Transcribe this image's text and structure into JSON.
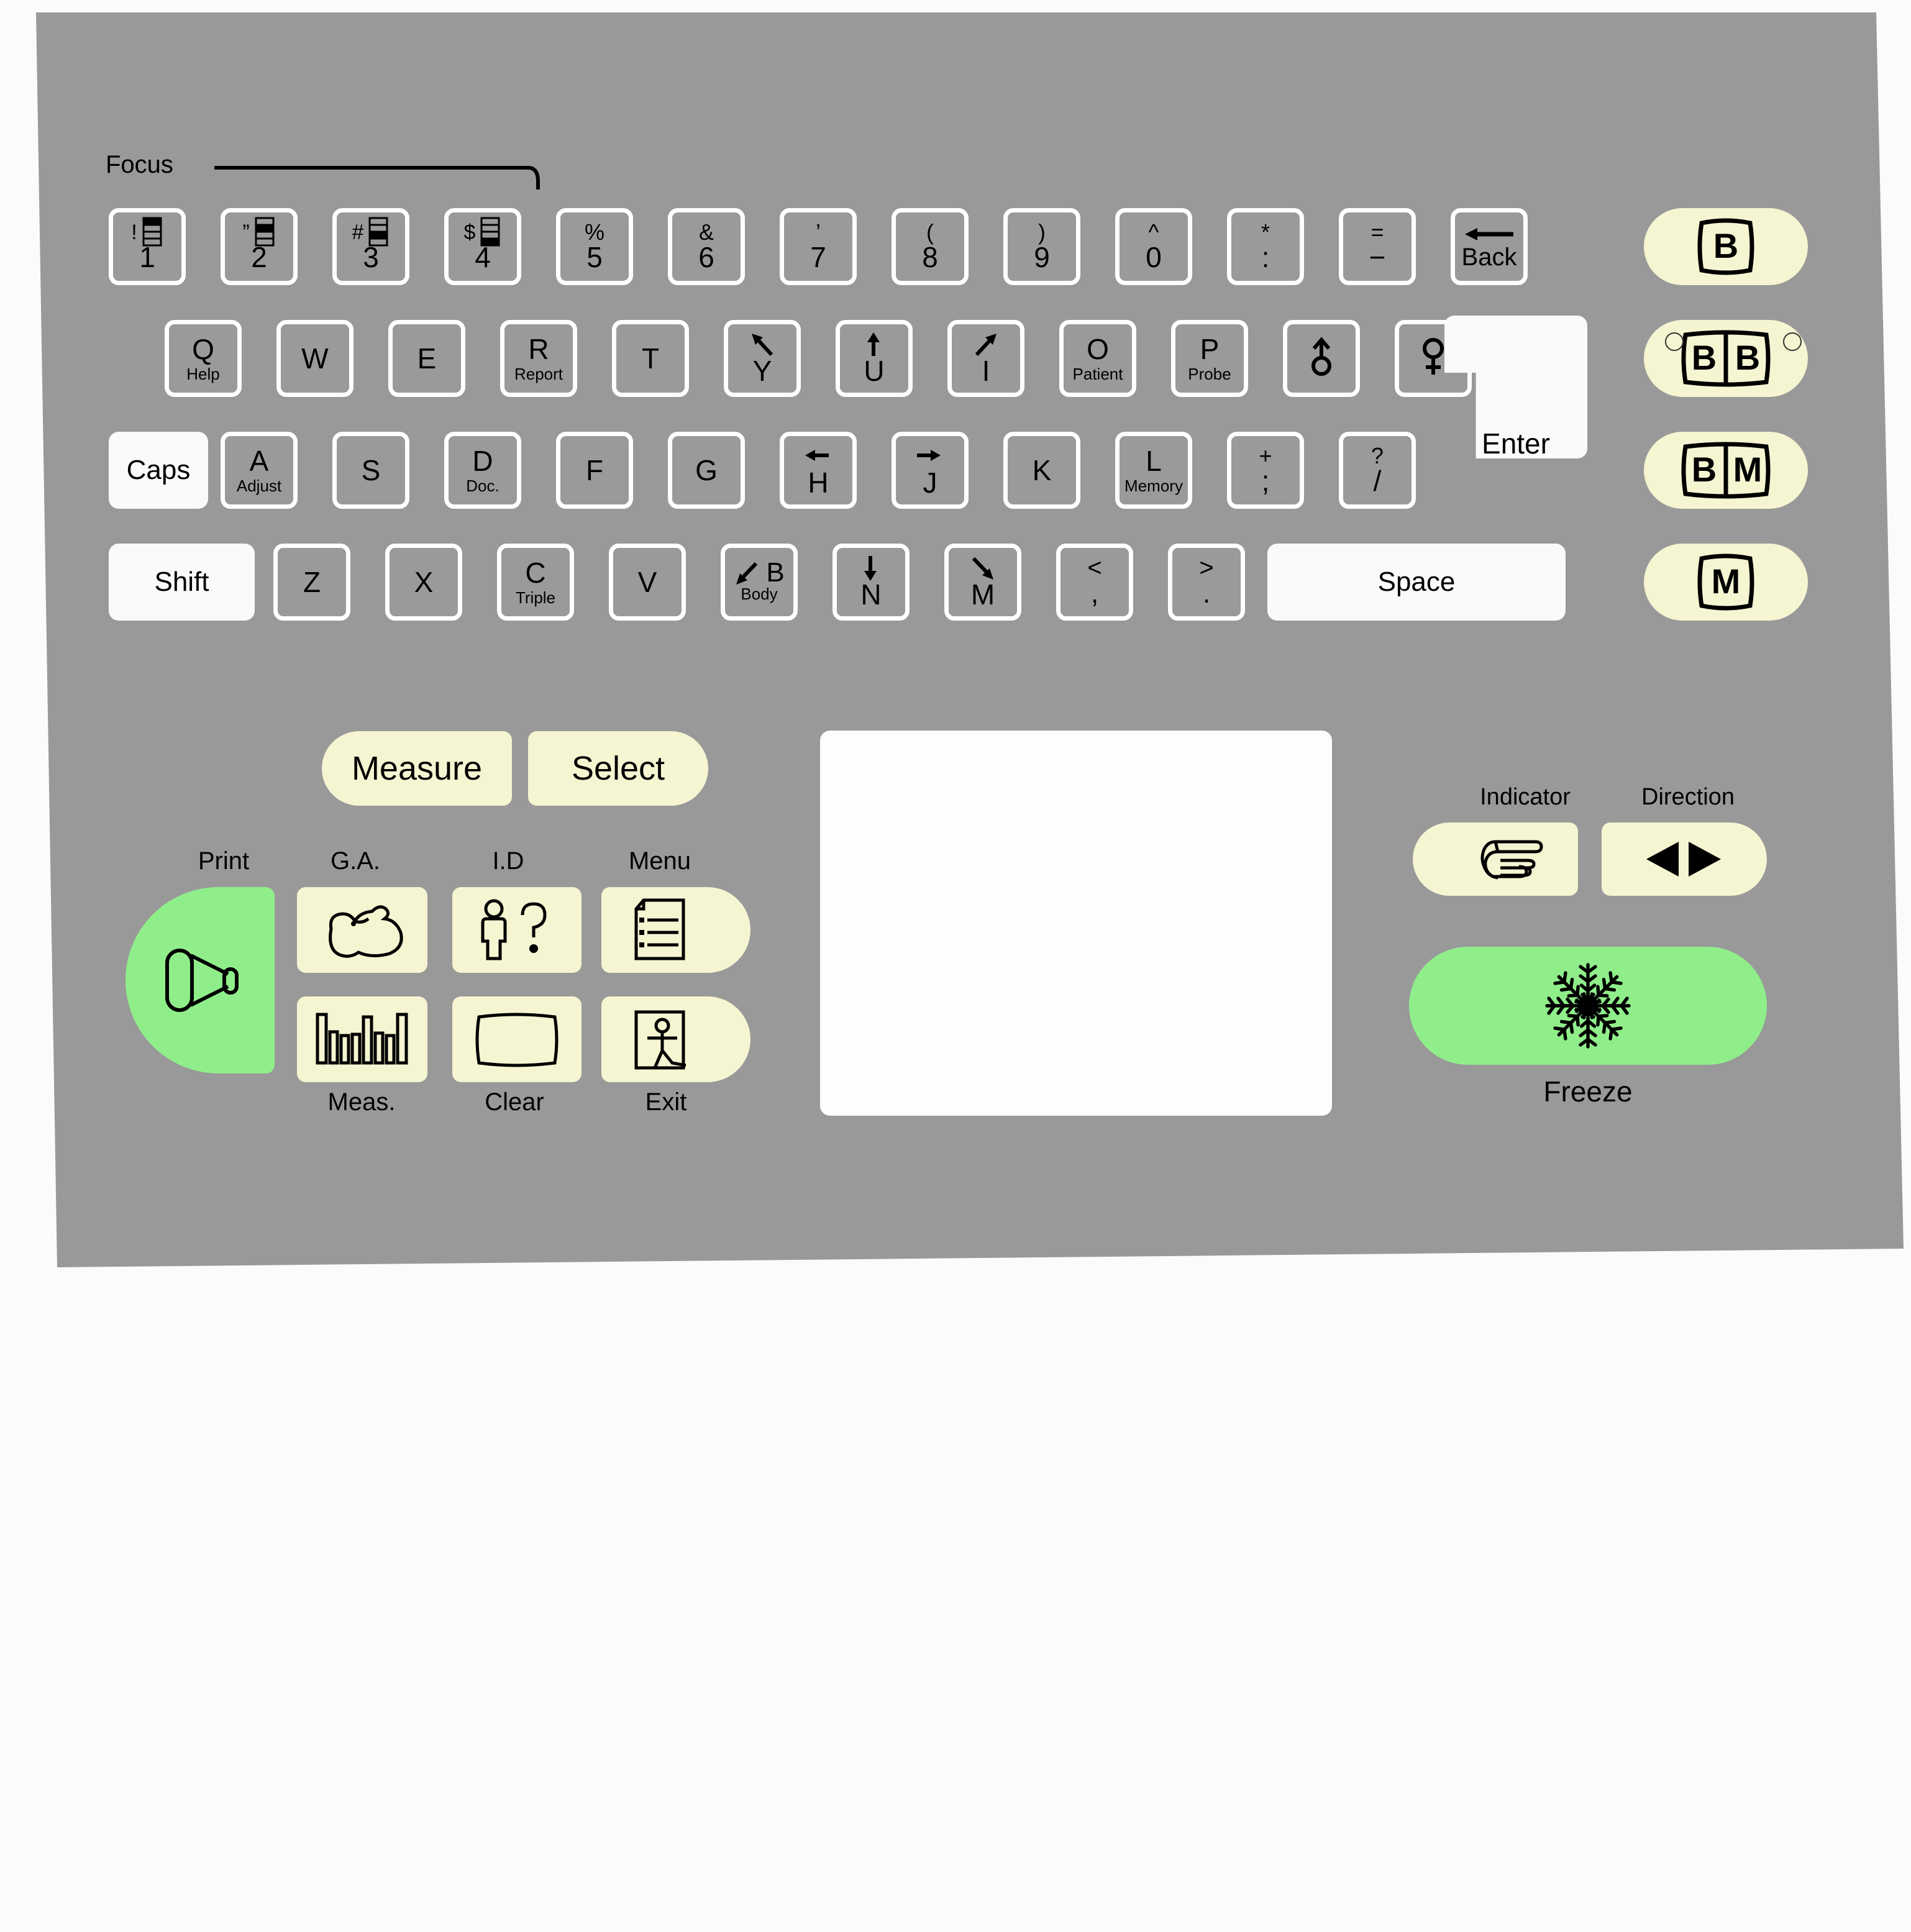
{
  "panel": {
    "name": "ultrasound-control-panel",
    "colors": {
      "body": "#999999",
      "key_face": "#9a9a9a",
      "key_border": "#ffffff",
      "modifier_key": "#fafafa",
      "function_key": "#f5f5d2",
      "action_key": "#90ee8a",
      "led": "#d3d3d3"
    }
  },
  "focus": {
    "label": "Focus",
    "bracket": "focus-bracket-line",
    "keys": [
      {
        "shift": "!",
        "main": "1",
        "icon": "focus-depth-icon-1"
      },
      {
        "shift": "”",
        "main": "2",
        "icon": "focus-depth-icon-2"
      },
      {
        "shift": "#",
        "main": "3",
        "icon": "focus-depth-icon-3"
      },
      {
        "shift": "$",
        "main": "4",
        "icon": "focus-depth-icon-4"
      }
    ]
  },
  "number_row": [
    {
      "shift": "%",
      "main": "5"
    },
    {
      "shift": "&",
      "main": "6"
    },
    {
      "shift": "’",
      "main": "7"
    },
    {
      "shift": "(",
      "main": "8"
    },
    {
      "shift": ")",
      "main": "9"
    },
    {
      "shift": "^",
      "main": "0"
    },
    {
      "shift": "*",
      "main": ":"
    },
    {
      "shift": "=",
      "main": "−"
    },
    {
      "shift": "",
      "main": "Back",
      "icon": "back-arrow-icon"
    }
  ],
  "row_q": [
    {
      "main": "Q",
      "sub": "Help"
    },
    {
      "main": "W",
      "sub": ""
    },
    {
      "main": "E",
      "sub": ""
    },
    {
      "main": "R",
      "sub": "Report"
    },
    {
      "main": "T",
      "sub": ""
    },
    {
      "main": "Y",
      "sub": "",
      "icon": "arrow-up-left-icon"
    },
    {
      "main": "U",
      "sub": "",
      "icon": "arrow-up-icon"
    },
    {
      "main": "I",
      "sub": "",
      "icon": "arrow-up-right-icon"
    },
    {
      "main": "O",
      "sub": "Patient"
    },
    {
      "main": "P",
      "sub": "Probe"
    },
    {
      "main": "",
      "sub": "",
      "icon": "male-symbol-icon"
    },
    {
      "main": "",
      "sub": "",
      "icon": "female-symbol-icon"
    }
  ],
  "row_a": {
    "caps": "Caps",
    "keys": [
      {
        "main": "A",
        "sub": "Adjust"
      },
      {
        "main": "S",
        "sub": ""
      },
      {
        "main": "D",
        "sub": "Doc."
      },
      {
        "main": "F",
        "sub": ""
      },
      {
        "main": "G",
        "sub": ""
      },
      {
        "main": "H",
        "sub": "",
        "icon": "arrow-left-icon"
      },
      {
        "main": "J",
        "sub": "",
        "icon": "arrow-right-icon"
      },
      {
        "main": "K",
        "sub": ""
      },
      {
        "main": "L",
        "sub": "Memory"
      },
      {
        "shift": "+",
        "main": ";"
      },
      {
        "shift": "?",
        "main": "/"
      }
    ],
    "enter": "Enter"
  },
  "row_z": {
    "shift": "Shift",
    "keys": [
      {
        "main": "Z",
        "sub": ""
      },
      {
        "main": "X",
        "sub": ""
      },
      {
        "main": "C",
        "sub": "Triple"
      },
      {
        "main": "V",
        "sub": ""
      },
      {
        "main": "B",
        "sub": "Body",
        "icon": "arrow-down-left-icon"
      },
      {
        "main": "N",
        "sub": "",
        "icon": "arrow-down-icon"
      },
      {
        "main": "M",
        "sub": "",
        "icon": "arrow-down-right-icon"
      },
      {
        "shift": "<",
        "main": ","
      },
      {
        "shift": ">",
        "main": "."
      }
    ],
    "space": "Space"
  },
  "mode_buttons": [
    {
      "label": "B",
      "name": "mode-b-button",
      "leds": 0
    },
    {
      "label": "BB",
      "name": "mode-bb-button",
      "leds": 2
    },
    {
      "label": "BM",
      "name": "mode-bm-button",
      "leds": 0
    },
    {
      "label": "M",
      "name": "mode-m-button",
      "leds": 0
    }
  ],
  "lower": {
    "measure": "Measure",
    "select": "Select",
    "print": {
      "label": "Print",
      "icon": "transducer-probe-icon"
    },
    "ga": {
      "label": "G.A.",
      "icon": "fetus-icon"
    },
    "id": {
      "label": "I.D",
      "icon": "patient-question-icon"
    },
    "menu": {
      "label": "Menu",
      "icon": "document-list-icon"
    },
    "meas": {
      "label": "Meas.",
      "icon": "caliper-bars-icon"
    },
    "clear": {
      "label": "Clear",
      "icon": "empty-screen-icon"
    },
    "exit": {
      "label": "Exit",
      "icon": "exit-door-icon"
    },
    "trackpad": "trackpad-area"
  },
  "right_panel": {
    "indicator": {
      "label": "Indicator",
      "icon": "pointing-hand-icon",
      "leds": 1
    },
    "direction": {
      "label": "Direction",
      "icon": "left-right-triangles-icon",
      "leds": 2
    },
    "freeze": {
      "label": "Freeze",
      "icon": "snowflake-icon",
      "leds": 1
    }
  }
}
